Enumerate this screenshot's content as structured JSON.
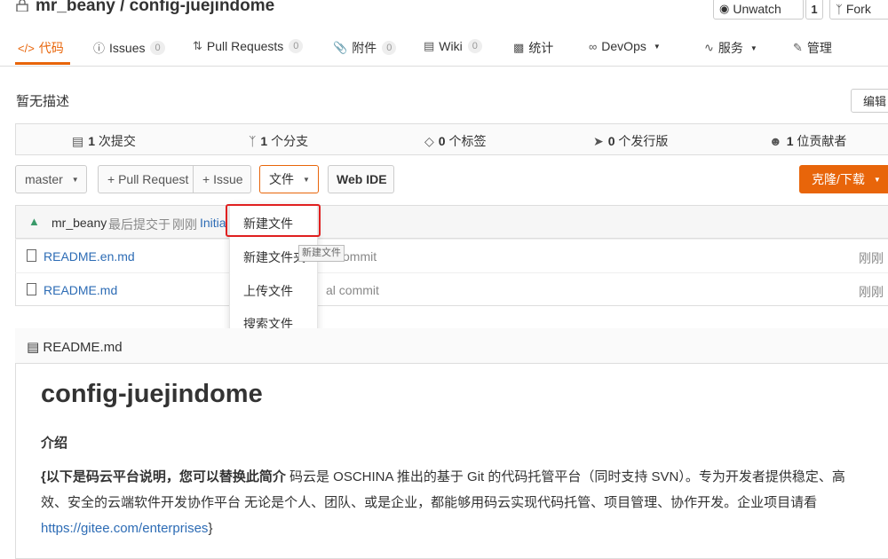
{
  "header": {
    "owner": "mr_beany",
    "separator": "/",
    "repo": "config-juejindome",
    "watch_label": "Unwatch",
    "watch_count": "1",
    "fork_label": "Fork"
  },
  "tabs": [
    {
      "label": "代码",
      "icon": "code-icon",
      "badge": ""
    },
    {
      "label": "Issues",
      "icon": "issue-icon",
      "badge": "0"
    },
    {
      "label": "Pull Requests",
      "icon": "pull-request-icon",
      "badge": "0"
    },
    {
      "label": "附件",
      "icon": "attachment-icon",
      "badge": "0"
    },
    {
      "label": "Wiki",
      "icon": "wiki-icon",
      "badge": "0"
    },
    {
      "label": "统计",
      "icon": "stats-icon",
      "badge": ""
    },
    {
      "label": "DevOps",
      "icon": "devops-icon",
      "badge": ""
    },
    {
      "label": "服务",
      "icon": "service-icon",
      "badge": ""
    },
    {
      "label": "管理",
      "icon": "manage-icon",
      "badge": ""
    }
  ],
  "description": "暂无描述",
  "edit_label": "编辑",
  "stats": {
    "commits_count": "1",
    "commits_label": "次提交",
    "branches_count": "1",
    "branches_label": "个分支",
    "tags_count": "0",
    "tags_label": "个标签",
    "releases_count": "0",
    "releases_label": "个发行版",
    "contributors_count": "1",
    "contributors_label": "位贡献者"
  },
  "toolbar": {
    "branch": "master",
    "pull_request": "+ Pull Request",
    "issue": "+ Issue",
    "file": "文件",
    "web_ide": "Web IDE",
    "clone": "克隆/下载"
  },
  "commit_bar": {
    "user": "mr_beany",
    "text": "最后提交于",
    "time": "刚刚",
    "message": "Initia"
  },
  "files": [
    {
      "name": "README.en.md",
      "message": "commit",
      "time": "刚刚"
    },
    {
      "name": "README.md",
      "message": "al commit",
      "time": "刚刚"
    }
  ],
  "file_menu": {
    "items": [
      "新建文件",
      "新建文件夹",
      "上传文件",
      "搜索文件"
    ],
    "tooltip": "新建文件"
  },
  "readme": {
    "filename": "README.md",
    "heading": "config-juejindome",
    "subheading": "介绍",
    "intro_bold": "{以下是码云平台说明，您可以替换此简介",
    "intro_text": " 码云是 OSCHINA 推出的基于 Git 的代码托管平台（同时支持 SVN）。专为开发者提供稳定、高效、安全的云端软件开发协作平台 无论是个人、团队、或是企业，都能够用码云实现代码托管、项目管理、协作开发。企业项目请看 ",
    "link": "https://gitee.com/enterprises",
    "intro_end": "}"
  },
  "colors": {
    "accent": "#e8650a",
    "link": "#2d6cb5",
    "highlight": "#e02020"
  }
}
